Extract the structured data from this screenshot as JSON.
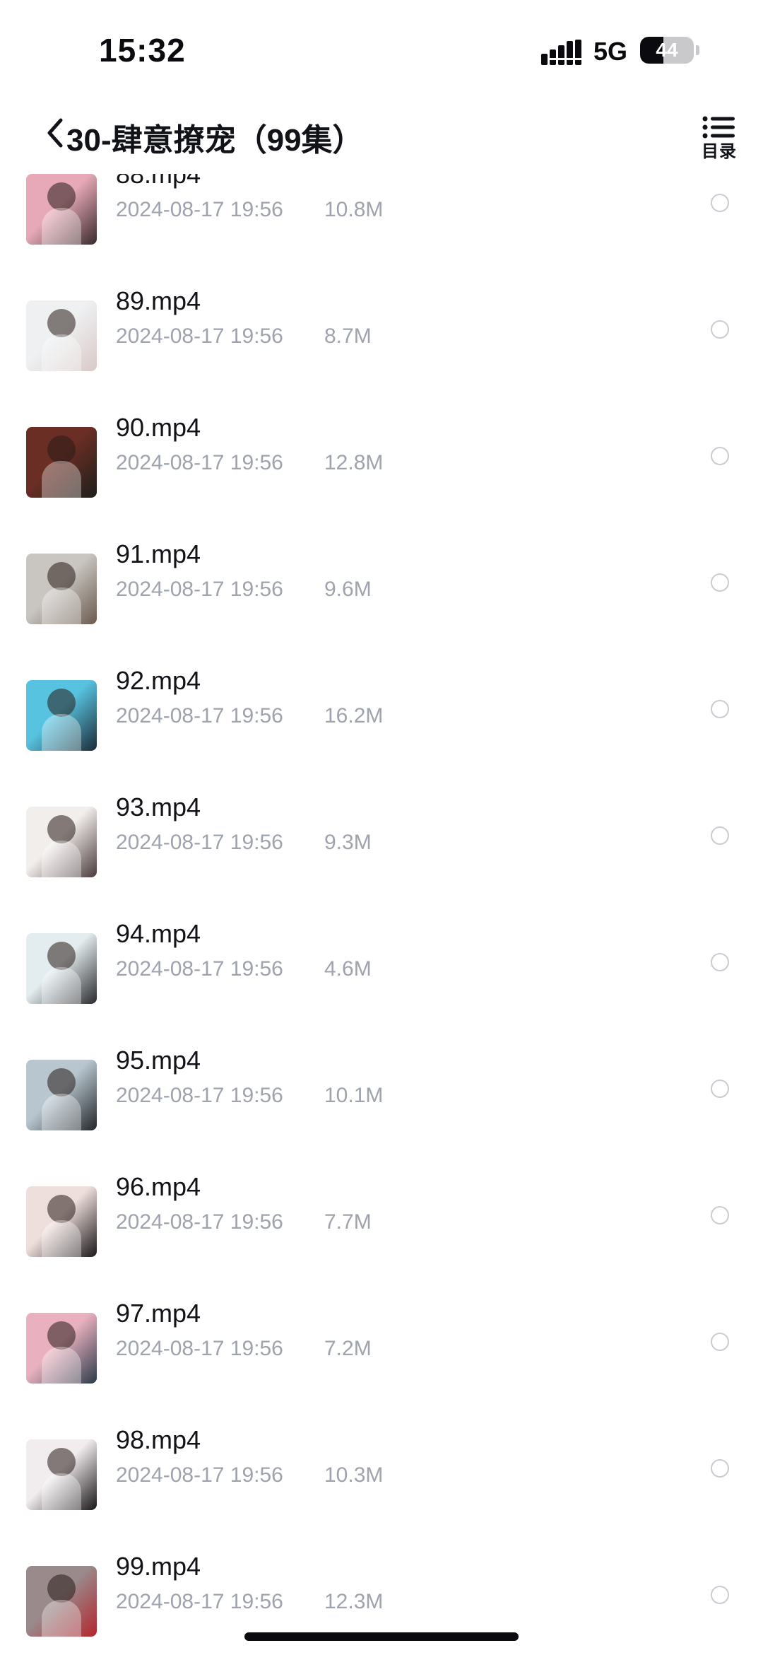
{
  "status_bar": {
    "time": "15:32",
    "network": "5G",
    "battery_level": "44",
    "battery_fraction": 0.44,
    "icons": [
      "signal-icon",
      "battery-icon"
    ]
  },
  "header": {
    "back_icon": "chevron-left-icon",
    "title": "30-肆意撩宠（99集）",
    "toc_icon": "list-icon",
    "toc_label": "目录"
  },
  "files": [
    {
      "name": "88.mp4",
      "date": "2024-08-17 19:56",
      "size": "10.8M",
      "thumb_colors": [
        "#e7a9b8",
        "#3a2a2c"
      ]
    },
    {
      "name": "89.mp4",
      "date": "2024-08-17 19:56",
      "size": "8.7M",
      "thumb_colors": [
        "#eef0f2",
        "#d9c9c6"
      ]
    },
    {
      "name": "90.mp4",
      "date": "2024-08-17 19:56",
      "size": "12.8M",
      "thumb_colors": [
        "#6b2e24",
        "#1d1f1c"
      ]
    },
    {
      "name": "91.mp4",
      "date": "2024-08-17 19:56",
      "size": "9.6M",
      "thumb_colors": [
        "#c9c6c2",
        "#6b5a4c"
      ]
    },
    {
      "name": "92.mp4",
      "date": "2024-08-17 19:56",
      "size": "16.2M",
      "thumb_colors": [
        "#58c3e0",
        "#1c2a36"
      ]
    },
    {
      "name": "93.mp4",
      "date": "2024-08-17 19:56",
      "size": "9.3M",
      "thumb_colors": [
        "#f2eeec",
        "#4a3a3c"
      ]
    },
    {
      "name": "94.mp4",
      "date": "2024-08-17 19:56",
      "size": "4.6M",
      "thumb_colors": [
        "#e3ecee",
        "#2a2a2e"
      ]
    },
    {
      "name": "95.mp4",
      "date": "2024-08-17 19:56",
      "size": "10.1M",
      "thumb_colors": [
        "#b7c6cf",
        "#232629"
      ]
    },
    {
      "name": "96.mp4",
      "date": "2024-08-17 19:56",
      "size": "7.7M",
      "thumb_colors": [
        "#efdfdc",
        "#1b1719"
      ]
    },
    {
      "name": "97.mp4",
      "date": "2024-08-17 19:56",
      "size": "7.2M",
      "thumb_colors": [
        "#e9b1bf",
        "#2c3a4a"
      ]
    },
    {
      "name": "98.mp4",
      "date": "2024-08-17 19:56",
      "size": "10.3M",
      "thumb_colors": [
        "#f1ecee",
        "#1a1718"
      ]
    },
    {
      "name": "99.mp4",
      "date": "2024-08-17 19:56",
      "size": "12.3M",
      "thumb_colors": [
        "#9a8a8c",
        "#b3262c"
      ]
    }
  ],
  "colors": {
    "accent_text": "#111318",
    "meta_text": "#9ea3ad",
    "radio_border": "#c9ccd2"
  }
}
